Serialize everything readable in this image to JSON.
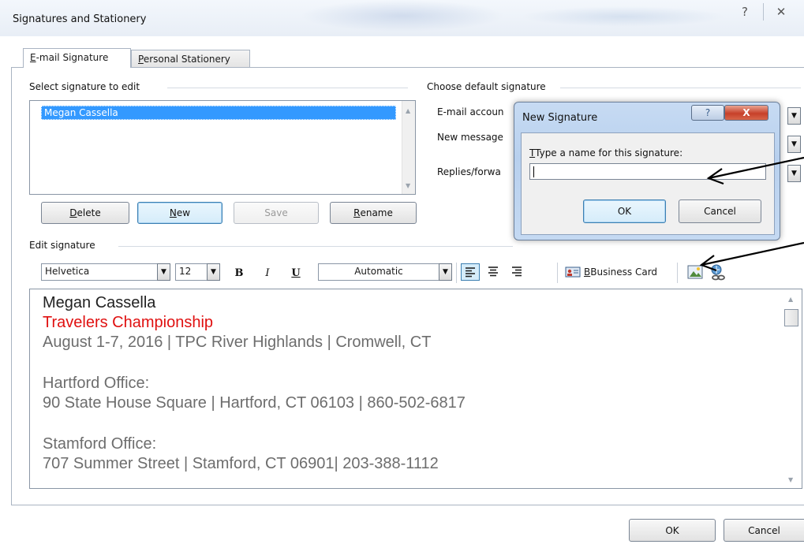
{
  "window": {
    "title": "Signatures and Stationery",
    "help_glyph": "?",
    "close_glyph": "✕"
  },
  "tabs": [
    {
      "label_pre": "E",
      "label_rest": "-mail Signature",
      "active": true
    },
    {
      "label_pre": "P",
      "label_rest": "ersonal Stationery",
      "active": false
    }
  ],
  "select_group": {
    "label": "Select signature to edit",
    "items": [
      "Megan Cassella"
    ]
  },
  "list_buttons": {
    "delete": {
      "pre": "D",
      "rest": "elete"
    },
    "new": {
      "pre": "N",
      "rest": "ew"
    },
    "save": "Save",
    "rename": {
      "pre": "R",
      "rest": "ename"
    }
  },
  "default_group": {
    "label": "Choose default signature",
    "email_account": "E-mail accoun",
    "new_messages": "New message",
    "replies": "Replies/forwa"
  },
  "edit_group": {
    "label": "Edit signature"
  },
  "toolbar": {
    "font": "Helvetica",
    "size": "12",
    "bold": "B",
    "italic": "I",
    "underline": "U",
    "color": "Automatic",
    "business_card": "Business Card",
    "colors": {
      "accent": "#3399ff"
    }
  },
  "signature": {
    "name": "Megan Cassella",
    "event": "Travelers Championship",
    "event_details": "August 1-7, 2016 | TPC River Highlands | Cromwell, CT",
    "office1_title": "Hartford Office:",
    "office1_address": "90 State House Square | Hartford, CT 06103 | 860-502-6817",
    "office2_title": "Stamford Office:",
    "office2_address": "707 Summer Street | Stamford, CT 06901| 203-388-1112",
    "colors": {
      "name": "#222222",
      "event": "#e01010",
      "body": "#6d6d6d"
    }
  },
  "new_signature_dialog": {
    "title": "New Signature",
    "prompt": "Type a name for this signature:",
    "input_value": "",
    "ok": "OK",
    "cancel": "Cancel",
    "help_glyph": "?",
    "close_glyph": "X"
  },
  "footer": {
    "ok": "OK",
    "cancel": "Cancel"
  }
}
